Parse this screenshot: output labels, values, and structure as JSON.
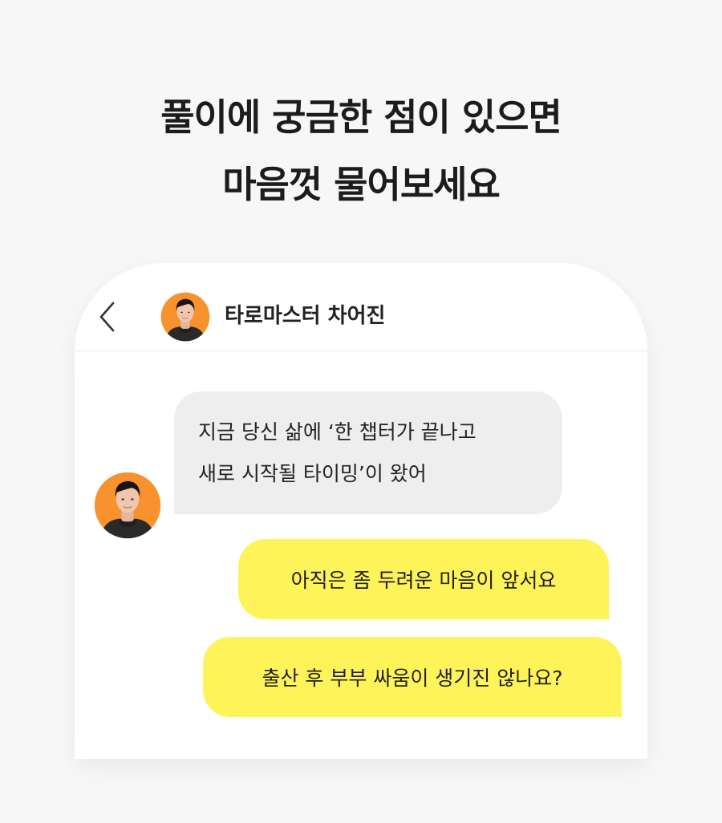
{
  "headline": {
    "line1": "풀이에 궁금한 점이 있으면",
    "line2": "마음껏 물어보세요"
  },
  "chat": {
    "header": {
      "back_icon": "chevron-left-icon",
      "name": "타로마스터 차어진"
    },
    "messages": [
      {
        "sender": "master",
        "lines": [
          "지금 당신 삶에 ‘한 챕터가 끝나고",
          "새로 시작될 타이밍’이 왔어"
        ]
      },
      {
        "sender": "user",
        "text": "아직은 좀 두려운 마음이 앞서요"
      },
      {
        "sender": "user",
        "text": "출산 후 부부 싸움이 생기진 않나요?"
      }
    ]
  },
  "colors": {
    "page_background": "#f7f7f7",
    "received_bubble": "#eeeeee",
    "sent_bubble": "#fff35a",
    "avatar_background": "#f7922f",
    "text": "#222222"
  }
}
